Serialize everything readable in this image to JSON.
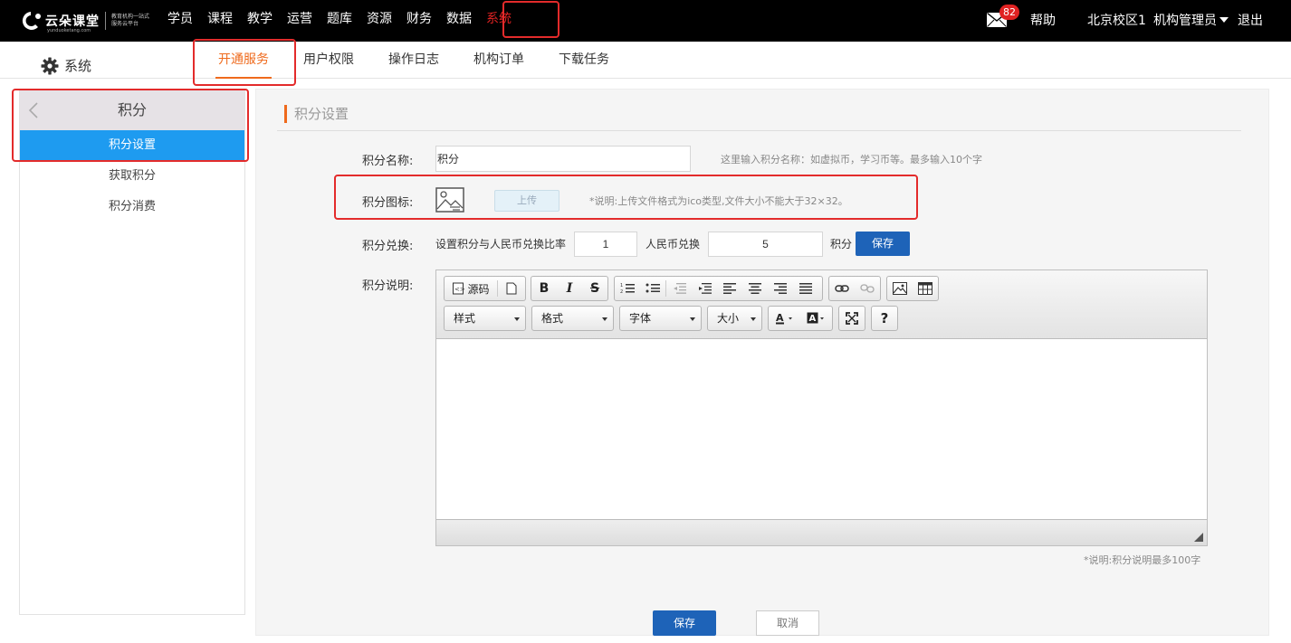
{
  "brand": {
    "name": "云朵课堂",
    "slogan": "教育机构一站式服务云平台",
    "domain": "yunduoketang.com"
  },
  "mainnav": [
    "学员",
    "课程",
    "教学",
    "运营",
    "题库",
    "资源",
    "财务",
    "数据",
    "系统"
  ],
  "topright": {
    "mail_count": "82",
    "help": "帮助",
    "campus": "北京校区1",
    "admin": "机构管理员",
    "logout": "退出"
  },
  "module_title": "系统",
  "subtabs": [
    "开通服务",
    "用户权限",
    "操作日志",
    "机构订单",
    "下载任务"
  ],
  "sidebar": {
    "title": "积分",
    "items": [
      "积分设置",
      "获取积分",
      "积分消费"
    ]
  },
  "section_title": "积分设置",
  "form": {
    "name_label": "积分名称:",
    "name_value": "积分",
    "name_hint": "这里输入积分名称：如虚拟币，学习币等。最多输入10个字",
    "icon_label": "积分图标:",
    "upload_label": "上传",
    "icon_hint": "*说明:上传文件格式为ico类型,文件大小不能大于32×32。",
    "exchange_label": "积分兑换:",
    "exchange_text": "设置积分与人民币兑换比率",
    "rmb_value": "1",
    "rmb_text": "人民币兑换",
    "points_value": "5",
    "points_unit": "积分",
    "exchange_save": "保存",
    "desc_label": "积分说明:",
    "desc_hint": "*说明:积分说明最多100字",
    "save": "保存",
    "cancel": "取消"
  },
  "editor": {
    "source_label": "源码",
    "combos": [
      "样式",
      "格式",
      "字体",
      "大小"
    ],
    "help": "?"
  }
}
